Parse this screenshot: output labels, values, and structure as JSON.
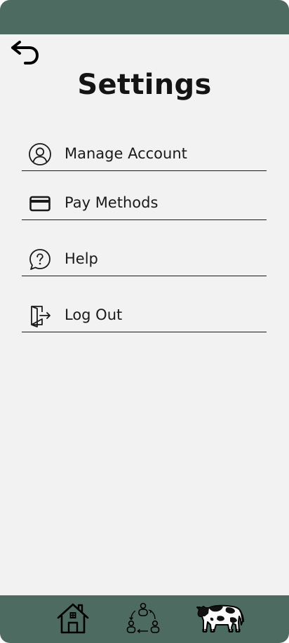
{
  "colors": {
    "header_bg": "#4e6b61",
    "page_bg": "#f2f2f2",
    "text": "#141414",
    "divider": "#1a1a1a"
  },
  "header": {
    "back_icon": "back-arrow-icon"
  },
  "page": {
    "title": "Settings"
  },
  "menu": {
    "items": [
      {
        "label": "Manage Account",
        "icon": "user-circle-icon"
      },
      {
        "label": "Pay Methods",
        "icon": "credit-card-icon"
      },
      {
        "label": "Help",
        "icon": "help-bubble-icon"
      },
      {
        "label": "Log Out",
        "icon": "logout-door-icon"
      }
    ]
  },
  "bottom_nav": {
    "items": [
      {
        "icon": "home-icon"
      },
      {
        "icon": "community-cycle-icon"
      },
      {
        "icon": "cow-icon"
      }
    ]
  }
}
